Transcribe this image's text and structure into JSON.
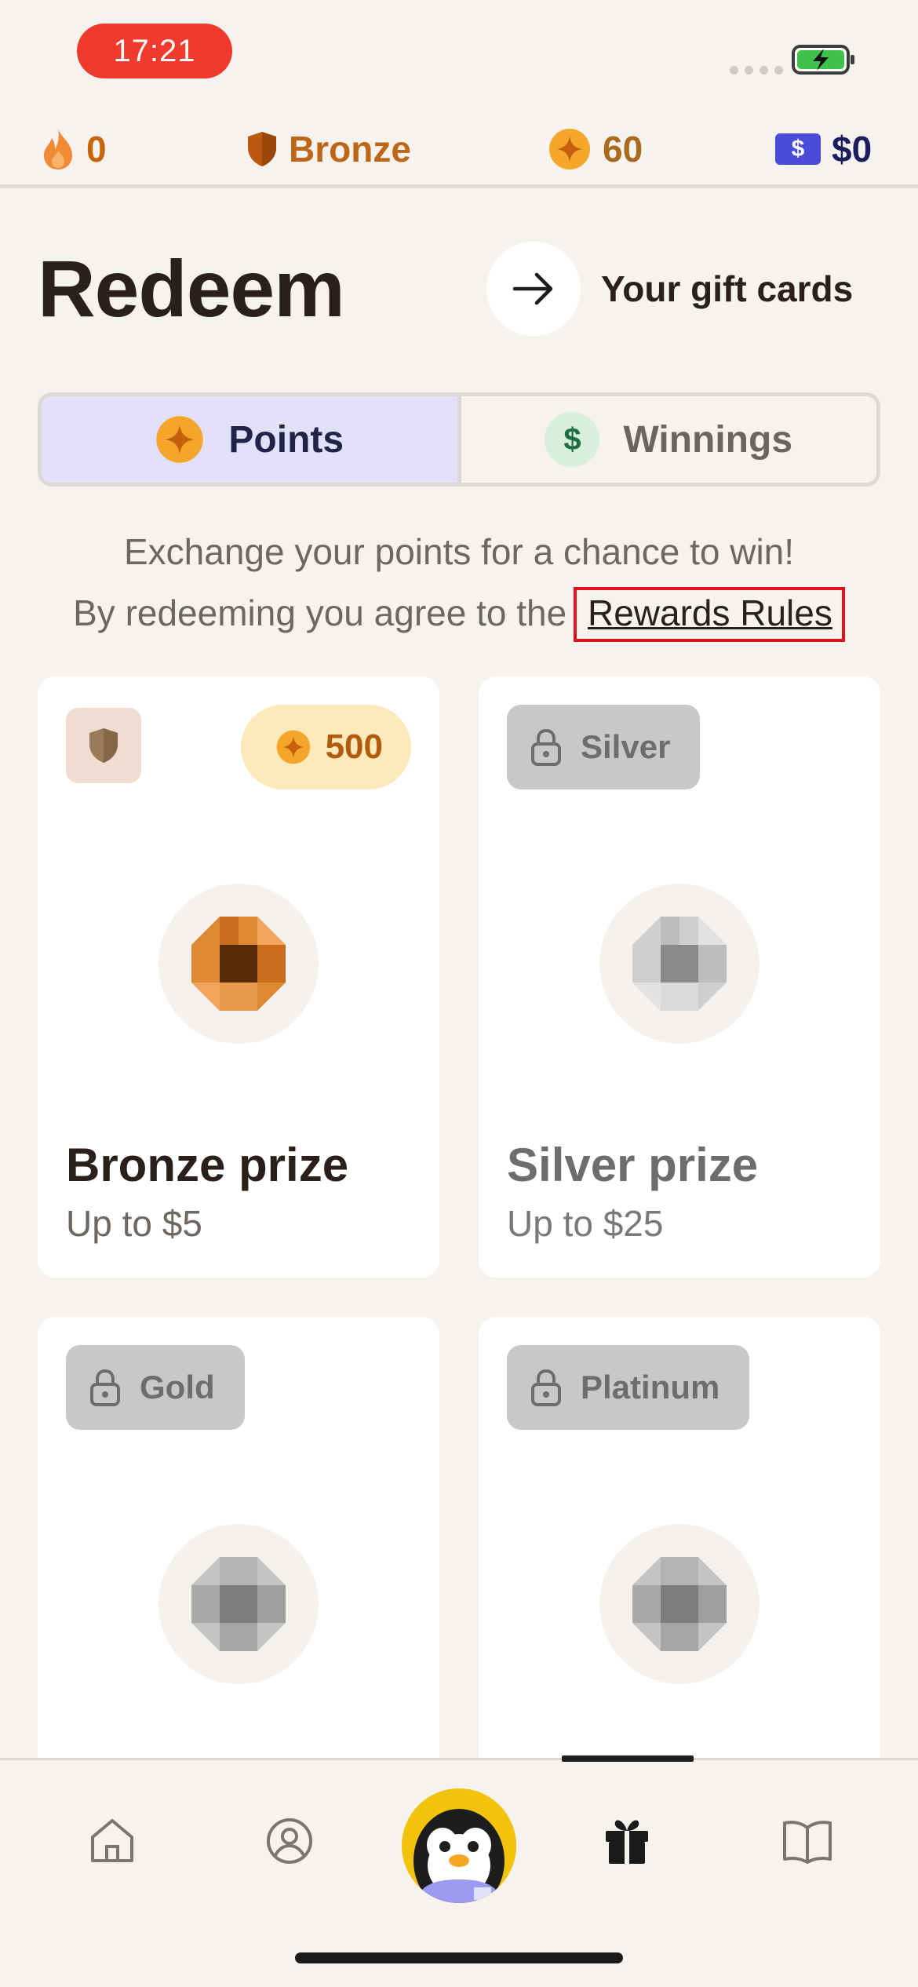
{
  "status_bar": {
    "time": "17:21"
  },
  "stats": {
    "streak": "0",
    "league": "Bronze",
    "points": "60",
    "cash_symbol": "$",
    "cash": "$0"
  },
  "header": {
    "title": "Redeem",
    "gift_cards_label": "Your gift cards"
  },
  "tabs": [
    {
      "label": "Points",
      "active": true
    },
    {
      "label": "Winnings",
      "active": false
    }
  ],
  "winnings_symbol": "$",
  "info": {
    "line1": "Exchange your points for a chance to win!",
    "line2_prefix": "By redeeming you agree to the",
    "rules_link": "Rewards Rules"
  },
  "prizes": [
    {
      "tier": "Bronze",
      "cost": "500",
      "name": "Bronze prize",
      "subtitle": "Up to $5",
      "locked": false
    },
    {
      "tier": "Silver",
      "lock_label": "Silver",
      "name": "Silver prize",
      "subtitle": "Up to $25",
      "locked": true
    },
    {
      "tier": "Gold",
      "lock_label": "Gold",
      "locked": true
    },
    {
      "tier": "Platinum",
      "lock_label": "Platinum",
      "locked": true
    }
  ],
  "bottom_nav": [
    {
      "icon": "home-icon"
    },
    {
      "icon": "profile-icon"
    },
    {
      "icon": "mascot-avatar"
    },
    {
      "icon": "gift-icon",
      "active": true
    },
    {
      "icon": "book-icon"
    }
  ],
  "colors": {
    "background": "#f6f3ef",
    "accent_active_tab": "#e2e0fb",
    "bronze": "#c8640c",
    "points_pill": "#fde9b9",
    "highlight_box": "#e0141c"
  }
}
